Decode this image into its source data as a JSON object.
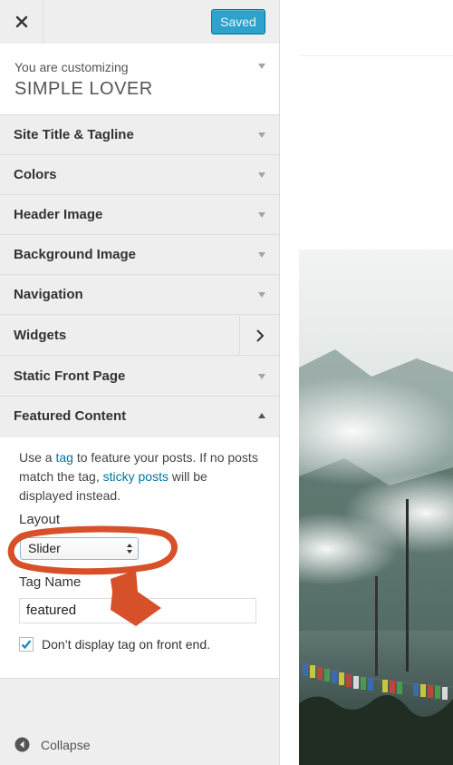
{
  "topbar": {
    "saved_label": "Saved"
  },
  "customizing": {
    "label": "You are customizing",
    "theme_name": "SIMPLE LOVER"
  },
  "sections": [
    {
      "label": "Site Title & Tagline"
    },
    {
      "label": "Colors"
    },
    {
      "label": "Header Image"
    },
    {
      "label": "Background Image"
    },
    {
      "label": "Navigation"
    },
    {
      "label": "Widgets"
    },
    {
      "label": "Static Front Page"
    },
    {
      "label": "Featured Content"
    }
  ],
  "featured": {
    "desc_part1": "Use a ",
    "desc_link1": "tag",
    "desc_part2": " to feature your posts. If no posts match the tag, ",
    "desc_link2": "sticky posts",
    "desc_part3": " will be displayed instead.",
    "layout_label": "Layout",
    "layout_value": "Slider",
    "tag_name_label": "Tag Name",
    "tag_name_value": "featured",
    "checkbox_label": "Don’t display tag on front end.",
    "checkbox_checked": true
  },
  "footer": {
    "collapse_label": "Collapse"
  },
  "colors": {
    "accent": "#2ea2cc",
    "link": "#0074a2",
    "annotation": "#d6512a"
  }
}
